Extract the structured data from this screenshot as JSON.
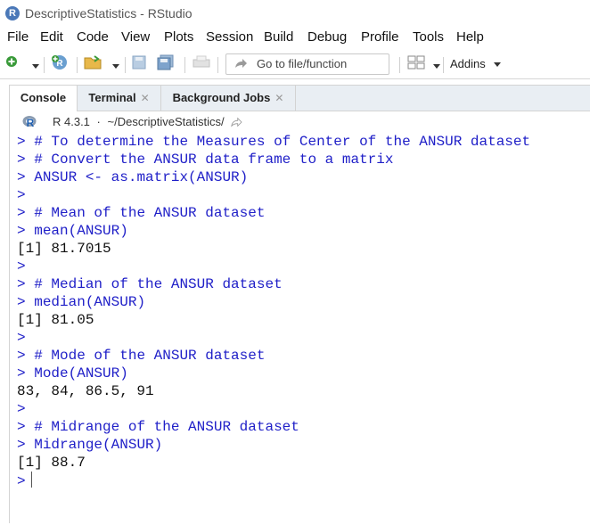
{
  "window": {
    "title": "DescriptiveStatistics - RStudio",
    "logo_letter": "R"
  },
  "menu": [
    "File",
    "Edit",
    "Code",
    "View",
    "Plots",
    "Session",
    "Build",
    "Debug",
    "Profile",
    "Tools",
    "Help"
  ],
  "toolbar": {
    "goto_placeholder": "Go to file/function",
    "addins_label": "Addins"
  },
  "tabs": [
    {
      "label": "Console",
      "active": true,
      "closable": false
    },
    {
      "label": "Terminal",
      "active": false,
      "closable": true
    },
    {
      "label": "Background Jobs",
      "active": false,
      "closable": true
    }
  ],
  "path": {
    "r_version": "R 4.3.1",
    "separator": "·",
    "directory": "~/DescriptiveStatistics/"
  },
  "console": {
    "prompt": ">",
    "lines": [
      {
        "type": "input",
        "text": "# To determine the Measures of Center of the ANSUR dataset"
      },
      {
        "type": "input",
        "text": "# Convert the ANSUR data frame to a matrix"
      },
      {
        "type": "input",
        "text": "ANSUR <- as.matrix(ANSUR)"
      },
      {
        "type": "input",
        "text": ""
      },
      {
        "type": "input",
        "text": "# Mean of the ANSUR dataset"
      },
      {
        "type": "input",
        "text": "mean(ANSUR)"
      },
      {
        "type": "output",
        "text": "[1] 81.7015"
      },
      {
        "type": "input",
        "text": ""
      },
      {
        "type": "input",
        "text": "# Median of the ANSUR dataset"
      },
      {
        "type": "input",
        "text": "median(ANSUR)"
      },
      {
        "type": "output",
        "text": "[1] 81.05"
      },
      {
        "type": "input",
        "text": ""
      },
      {
        "type": "input",
        "text": "# Mode of the ANSUR dataset"
      },
      {
        "type": "input",
        "text": "Mode(ANSUR)"
      },
      {
        "type": "output",
        "text": "83, 84, 86.5, 91"
      },
      {
        "type": "input",
        "text": ""
      },
      {
        "type": "input",
        "text": "# Midrange of the ANSUR dataset"
      },
      {
        "type": "input",
        "text": "Midrange(ANSUR)"
      },
      {
        "type": "output",
        "text": "[1] 88.7"
      }
    ]
  },
  "colors": {
    "prompt": "#2020c8",
    "output": "#111111",
    "tabbar": "#e9eef3"
  }
}
